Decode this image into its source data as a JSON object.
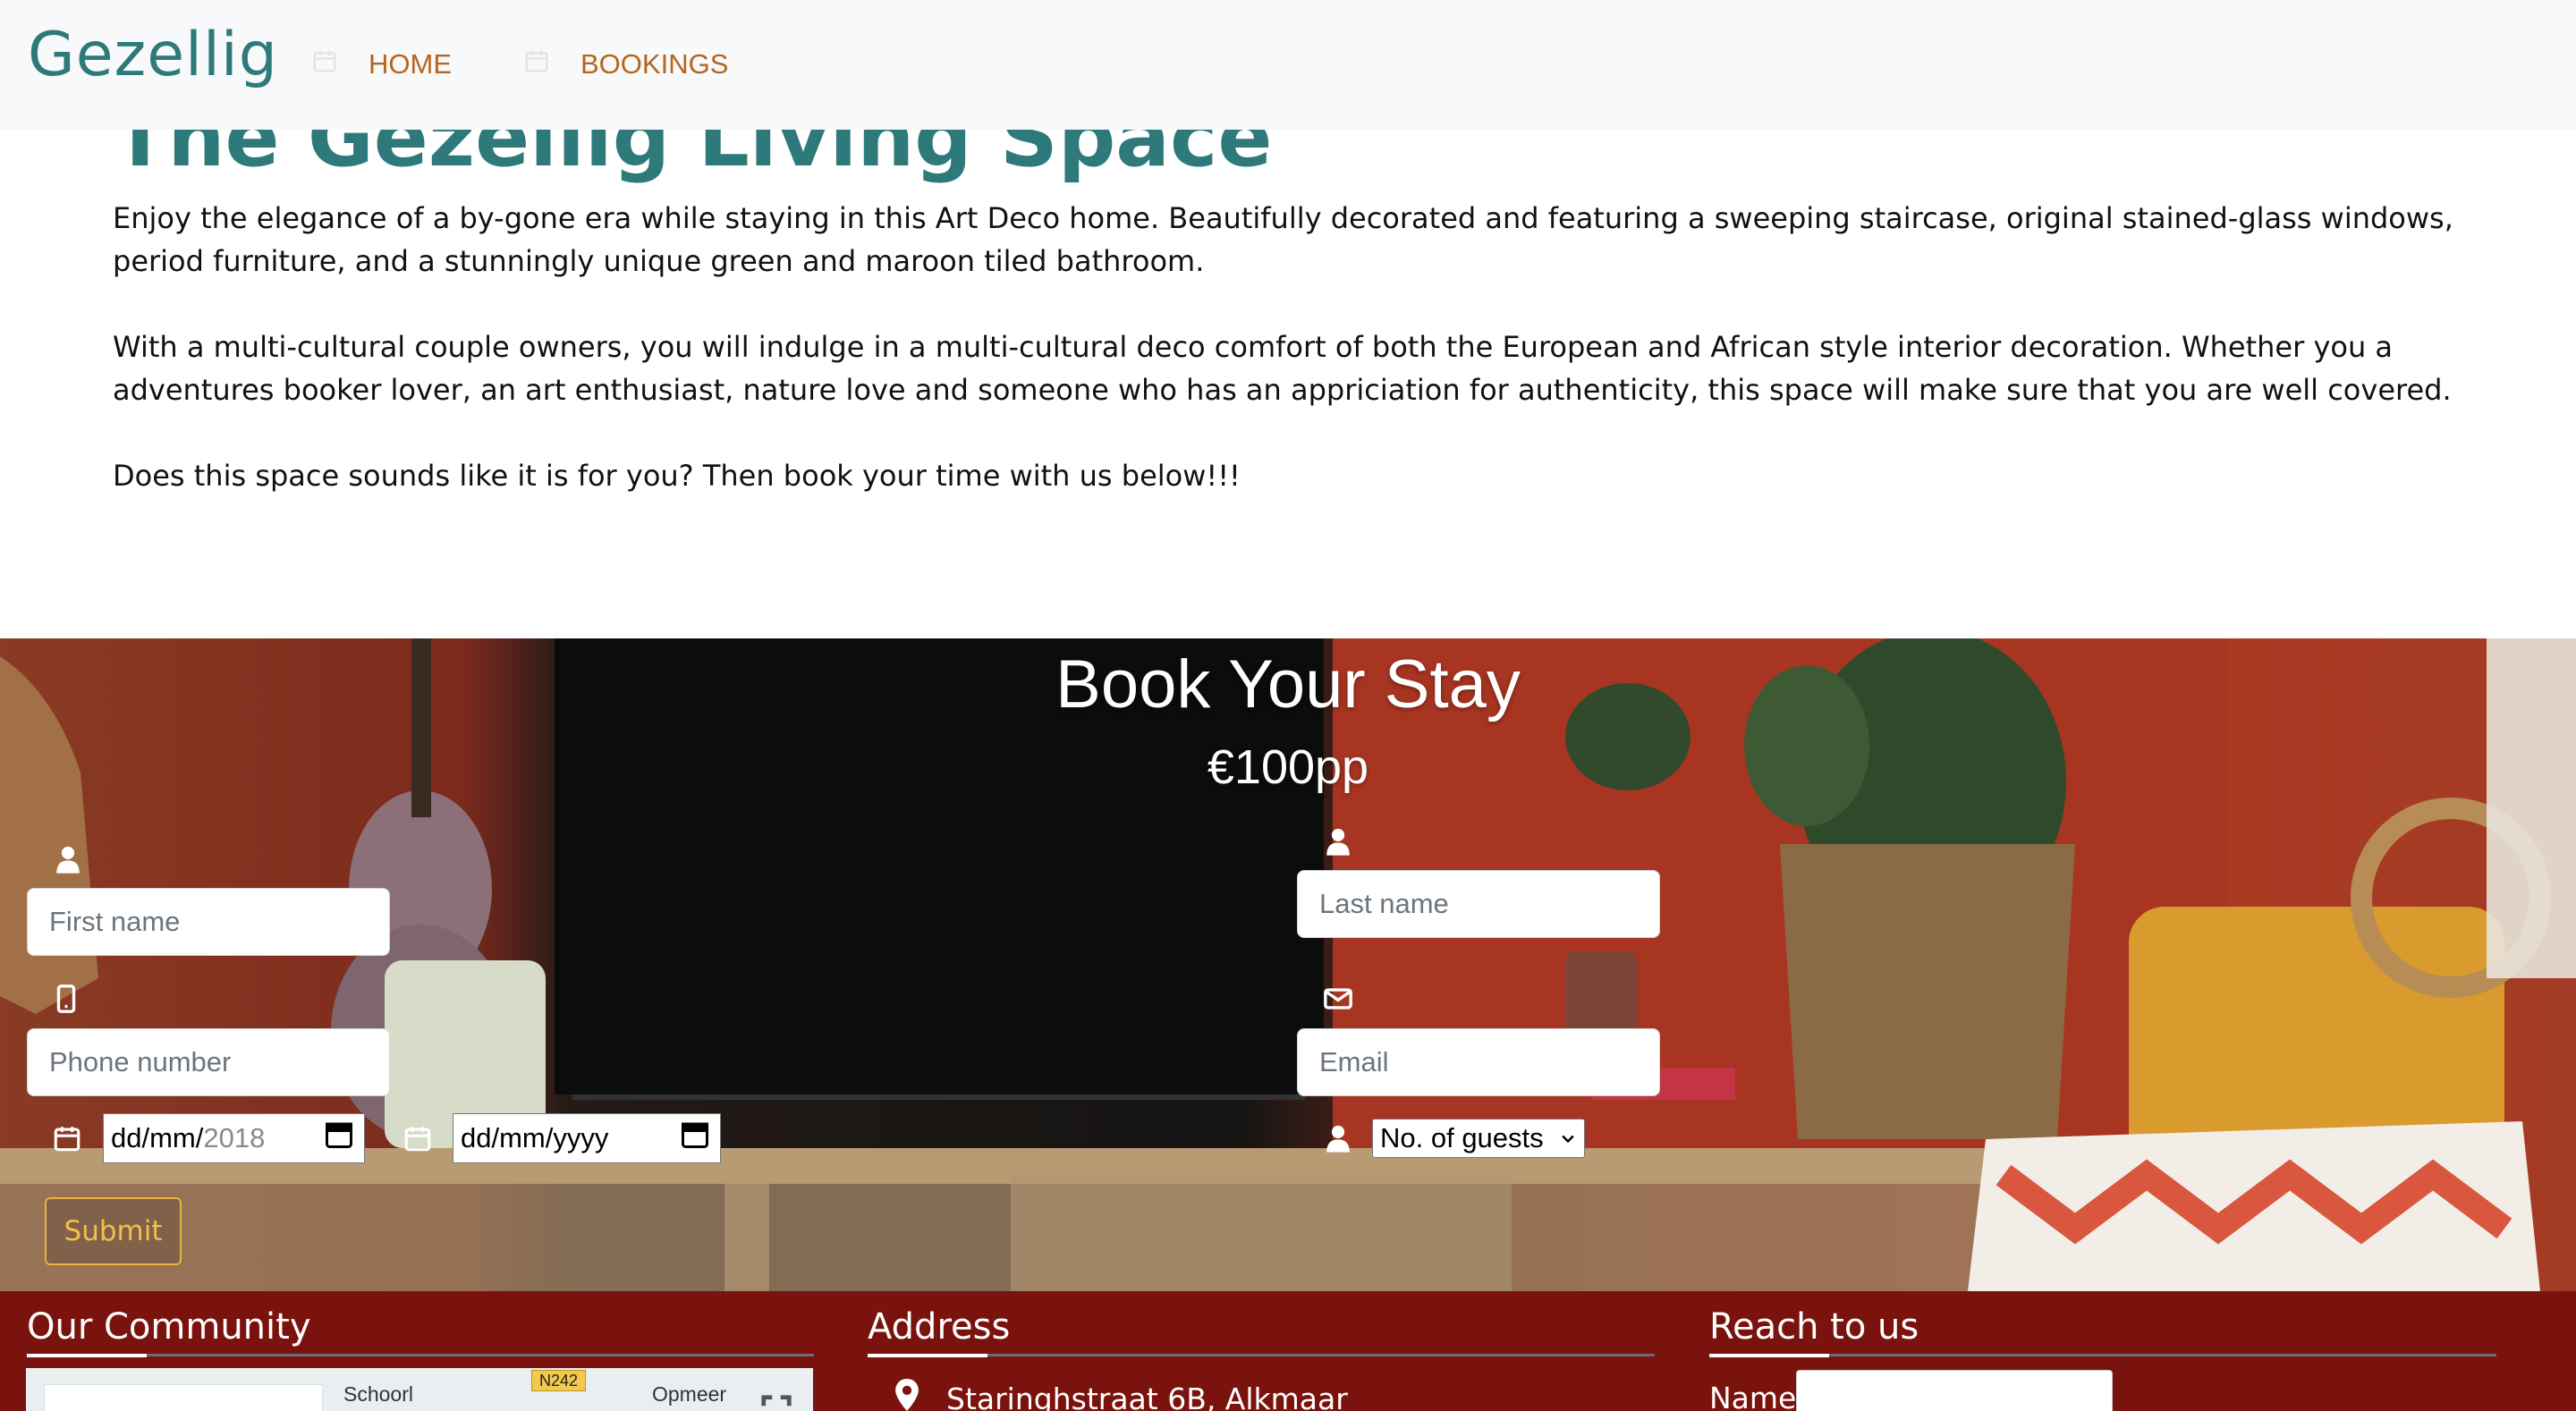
{
  "navbar": {
    "brand": "Gezellig",
    "items": [
      {
        "label": "HOME",
        "icon": "calendar-icon"
      },
      {
        "label": "BOOKINGS",
        "icon": "calendar-icon"
      }
    ]
  },
  "intro": {
    "title": "The Gezellig Living Space",
    "paragraphs": [
      "Enjoy the elegance of a by-gone era while staying in this Art Deco home. Beautifully decorated and featuring a sweeping staircase, original stained-glass windows, period furniture, and a stunningly unique green and maroon tiled bathroom.",
      "With a multi-cultural couple owners, you will indulge in a multi-cultural deco comfort of both the European and African style interior decoration. Whether you a adventures booker lover, an art enthusiast, nature love and someone who has an appriciation for authenticity, this space will make sure that you are well covered.",
      "Does this space sounds like it is for you? Then book your time with us below!!!"
    ]
  },
  "booking": {
    "title": "Book Your Stay",
    "price": "€100pp",
    "first_name_placeholder": "First name",
    "last_name_placeholder": "Last name",
    "phone_placeholder": "Phone number",
    "email_placeholder": "Email",
    "check_in": {
      "value_prefix": "dd/mm/",
      "value_suffix": "2018"
    },
    "check_out": {
      "value": "dd/mm/yyyy"
    },
    "guests_selected": "No. of guests",
    "submit_label": "Submit"
  },
  "footer": {
    "community": {
      "heading": "Our Community",
      "map_labels": [
        "Schoorl",
        "Opmeer"
      ],
      "map_road": "N242"
    },
    "address": {
      "heading": "Address",
      "line": "Staringhstraat 6B, Alkmaar"
    },
    "reach": {
      "heading": "Reach to us",
      "name_label": "Name"
    }
  },
  "colors": {
    "brand_teal": "#2e7a7a",
    "nav_link": "#b5651d",
    "footer_bg": "#7a130d",
    "submit_accent": "#e5b53d"
  }
}
